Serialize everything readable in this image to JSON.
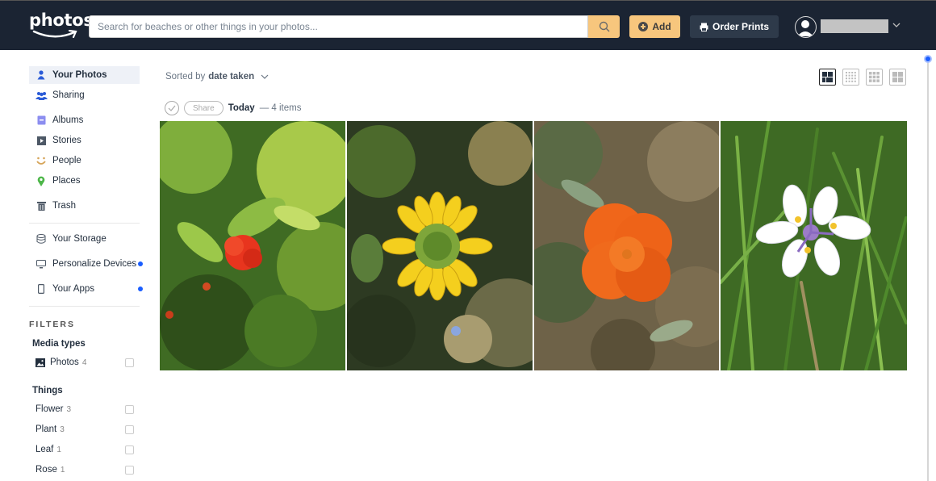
{
  "header": {
    "logo_text": "photos",
    "search_placeholder": "Search for beaches or other things in your photos...",
    "add_label": "Add",
    "order_prints_label": "Order Prints",
    "username_hidden": true
  },
  "sidebar": {
    "nav": [
      {
        "label": "Your Photos",
        "icon": "person-icon",
        "active": true
      },
      {
        "label": "Sharing",
        "icon": "people-group-icon"
      },
      {
        "label": "Albums",
        "icon": "album-icon"
      },
      {
        "label": "Stories",
        "icon": "play-icon"
      },
      {
        "label": "People",
        "icon": "smiley-icon"
      },
      {
        "label": "Places",
        "icon": "map-pin-icon"
      },
      {
        "label": "Trash",
        "icon": "trash-icon"
      }
    ],
    "secondary": [
      {
        "label": "Your Storage",
        "icon": "database-icon",
        "dot": false
      },
      {
        "label": "Personalize Devices",
        "icon": "monitor-icon",
        "dot": true
      },
      {
        "label": "Your Apps",
        "icon": "phone-icon",
        "dot": true
      }
    ],
    "filters_title": "FILTERS",
    "media_types": {
      "title": "Media types",
      "items": [
        {
          "label": "Photos",
          "count": "4",
          "checked": false
        }
      ]
    },
    "things": {
      "title": "Things",
      "items": [
        {
          "label": "Flower",
          "count": "3",
          "checked": false
        },
        {
          "label": "Plant",
          "count": "3",
          "checked": false
        },
        {
          "label": "Leaf",
          "count": "1",
          "checked": false
        },
        {
          "label": "Rose",
          "count": "1",
          "checked": false
        }
      ]
    }
  },
  "main": {
    "sort_prefix": "Sorted by",
    "sort_value": "date taken",
    "group": {
      "share_label": "Share",
      "title": "Today",
      "count_text": "— 4 items"
    },
    "view_modes": [
      "large-grid",
      "small-grid",
      "medium-grid",
      "square-grid"
    ],
    "active_view": "large-grid",
    "photos": [
      {
        "subject": "red pomegranate flower in green foliage"
      },
      {
        "subject": "yellow daisy-like flower"
      },
      {
        "subject": "orange California poppy"
      },
      {
        "subject": "white iris with purple center"
      }
    ]
  },
  "colors": {
    "header_bg": "#1b2433",
    "accent_orange": "#f7c67d",
    "accent_blue": "#1a5eff"
  }
}
